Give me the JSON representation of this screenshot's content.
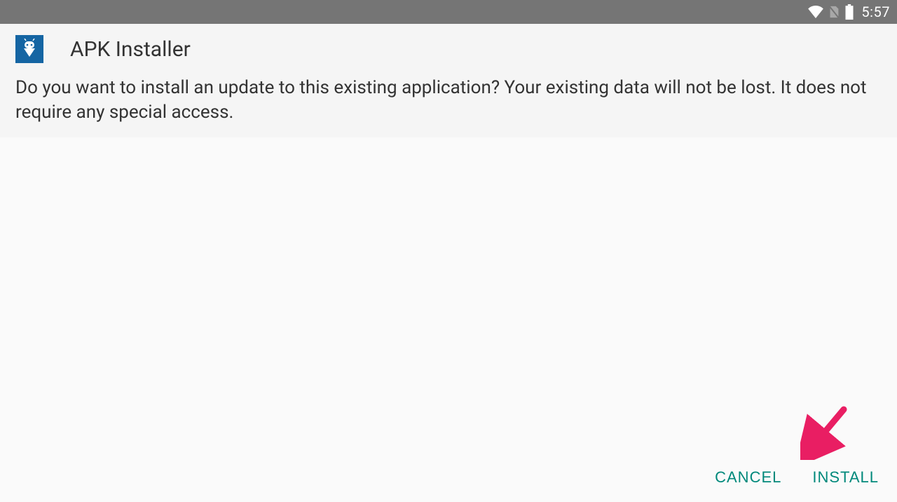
{
  "statusbar": {
    "time": "5:57"
  },
  "dialog": {
    "app_name": "APK Installer",
    "message": "Do you want to install an update to this existing application? Your existing data will not be lost. It does not require any special access.",
    "cancel_label": "CANCEL",
    "install_label": "INSTALL"
  }
}
